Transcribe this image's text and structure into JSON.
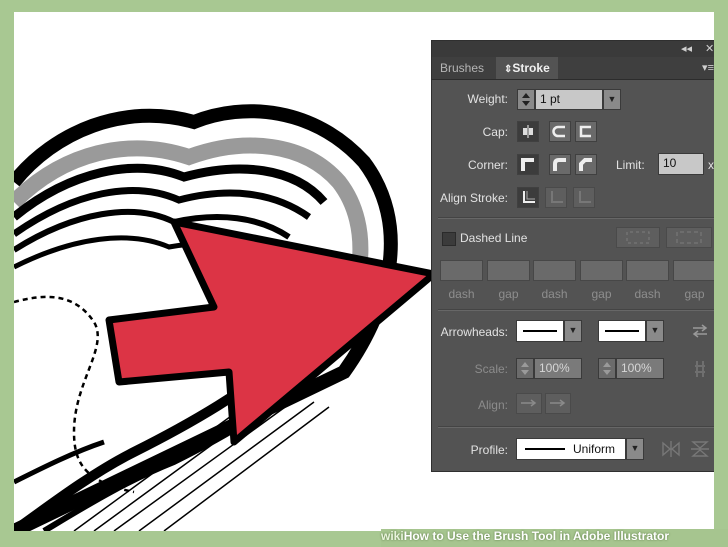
{
  "panel": {
    "tabs": [
      {
        "label": "Brushes",
        "active": false
      },
      {
        "label": "Stroke",
        "active": true
      }
    ],
    "weight": {
      "label": "Weight:",
      "value": "1 pt"
    },
    "cap": {
      "label": "Cap:"
    },
    "corner": {
      "label": "Corner:",
      "limit_label": "Limit:",
      "limit_value": "10",
      "limit_unit": "x"
    },
    "align_stroke": {
      "label": "Align Stroke:"
    },
    "dashed_line": {
      "label": "Dashed Line",
      "checked": false
    },
    "dash_gap_labels": [
      "dash",
      "gap",
      "dash",
      "gap",
      "dash",
      "gap"
    ],
    "arrowheads": {
      "label": "Arrowheads:"
    },
    "scale": {
      "label": "Scale:",
      "start": "100%",
      "end": "100%"
    },
    "align": {
      "label": "Align:"
    },
    "profile": {
      "label": "Profile:",
      "value": "Uniform"
    }
  },
  "colors": {
    "panel_bg": "#535353",
    "arrow_red": "#dc3445",
    "frame_green": "#a8c892"
  },
  "footer": {
    "brand": "wiki",
    "title": "How to Use the Brush Tool in Adobe Illustrator"
  }
}
